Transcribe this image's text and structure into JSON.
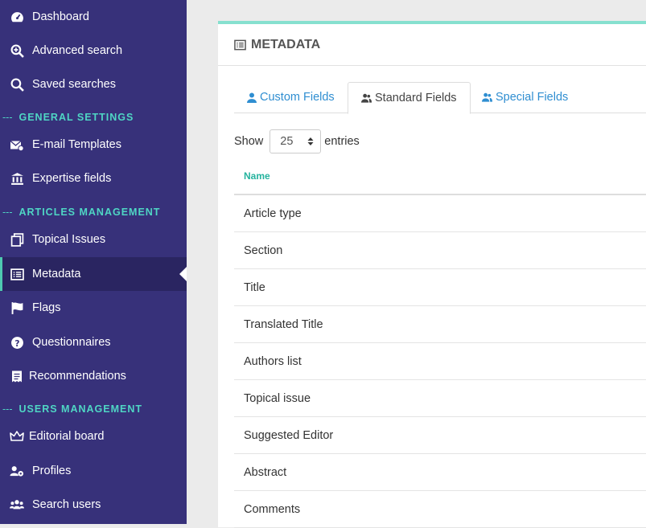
{
  "sidebar": {
    "items": [
      {
        "label": "Dashboard",
        "icon": "gauge-icon"
      },
      {
        "label": "Advanced search",
        "icon": "search-plus-icon"
      },
      {
        "label": "Saved searches",
        "icon": "search-icon"
      },
      {
        "label": "E-mail Templates",
        "icon": "envelope-icon"
      },
      {
        "label": "Expertise fields",
        "icon": "bank-icon"
      },
      {
        "label": "Topical Issues",
        "icon": "copy-icon"
      },
      {
        "label": "Metadata",
        "icon": "list-alt-icon"
      },
      {
        "label": "Flags",
        "icon": "flag-icon"
      },
      {
        "label": "Questionnaires",
        "icon": "question-circle-icon"
      },
      {
        "label": "Recommendations",
        "icon": "receipt-icon"
      },
      {
        "label": "Editorial board",
        "icon": "crown-icon"
      },
      {
        "label": "Profiles",
        "icon": "users-cog-icon"
      },
      {
        "label": "Search users",
        "icon": "users-icon"
      }
    ],
    "sections": {
      "general": "GENERAL SETTINGS",
      "articles": "ARTICLES MANAGEMENT",
      "users": "USERS MANAGEMENT"
    },
    "section_dash": "---"
  },
  "panel": {
    "title": "METADATA",
    "tabs": [
      {
        "label": "Custom Fields"
      },
      {
        "label": "Standard Fields"
      },
      {
        "label": "Special Fields"
      }
    ],
    "show_label": "Show",
    "entries_value": "25",
    "entries_label": "entries",
    "table": {
      "header": "Name",
      "rows": [
        "Article type",
        "Section",
        "Title",
        "Translated Title",
        "Authors list",
        "Topical issue",
        "Suggested Editor",
        "Abstract",
        "Comments"
      ]
    }
  },
  "colors": {
    "sidebar_bg": "#37317a",
    "sidebar_active": "#2a2561",
    "accent_teal": "#4fd6c4",
    "link_blue": "#2f8ed1"
  }
}
